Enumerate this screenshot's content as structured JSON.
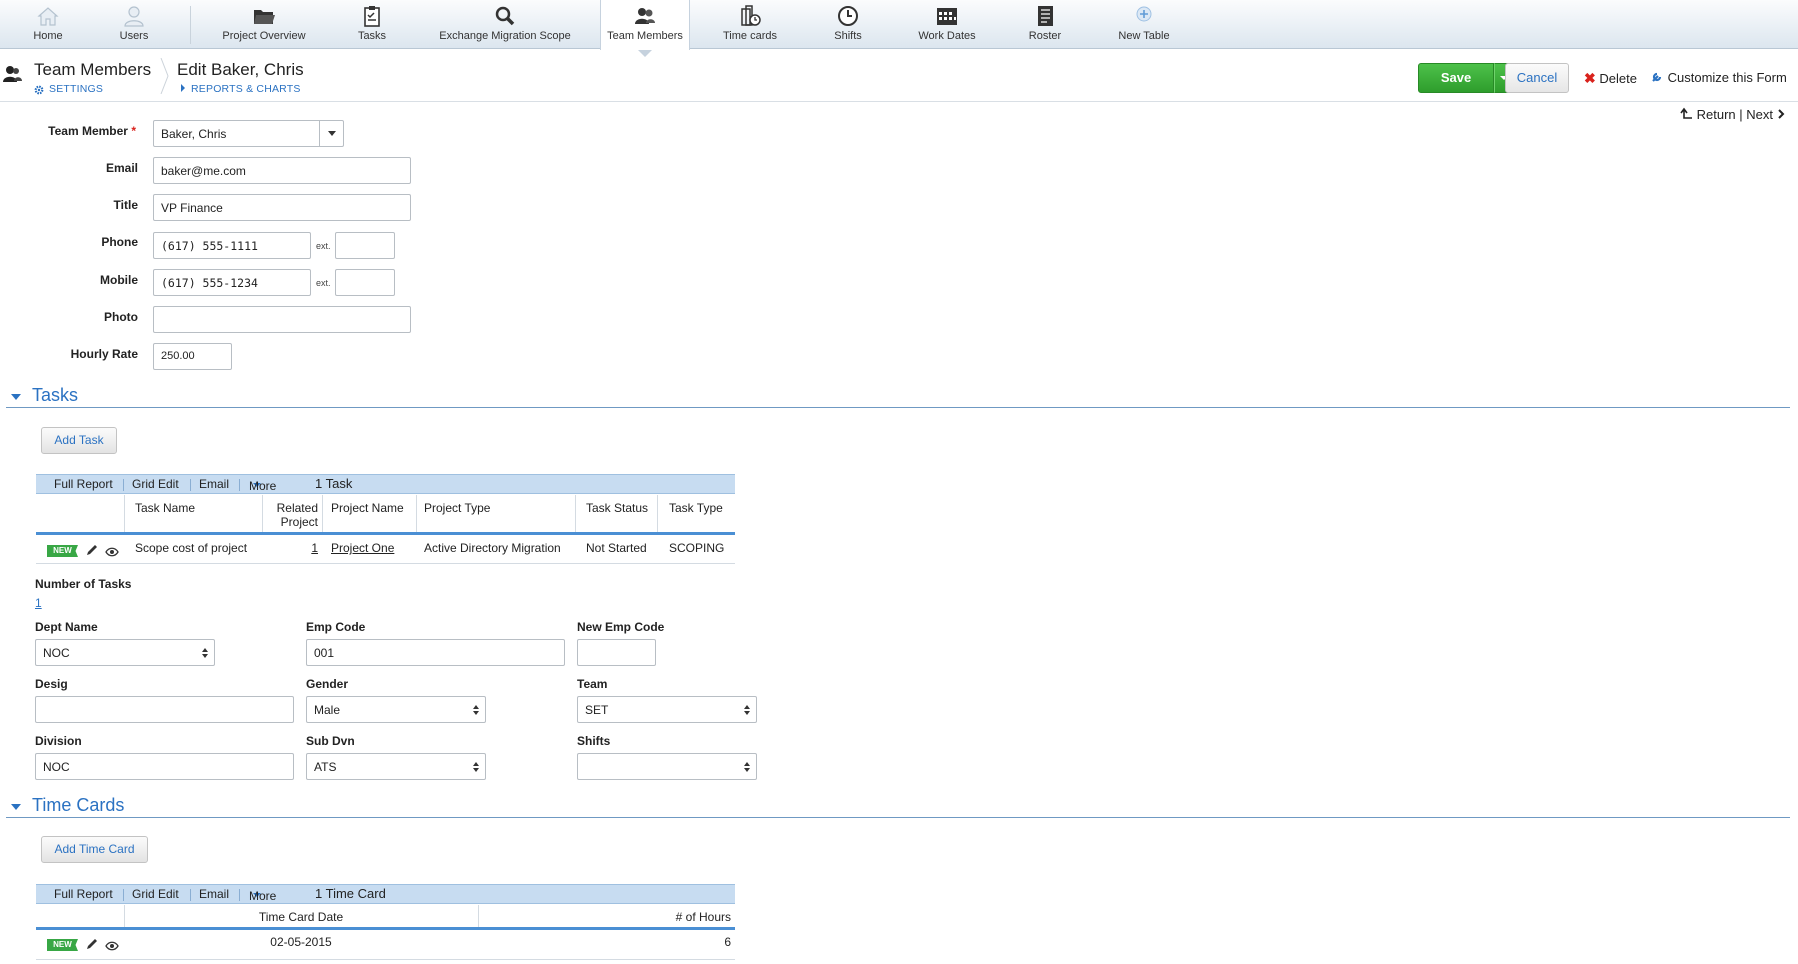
{
  "nav": {
    "items": [
      {
        "label": "Home",
        "icon": "home-icon"
      },
      {
        "label": "Users",
        "icon": "user-icon"
      },
      {
        "label": "Project Overview",
        "icon": "folder-icon"
      },
      {
        "label": "Tasks",
        "icon": "clipboard-icon"
      },
      {
        "label": "Exchange Migration Scope",
        "icon": "magnifier-icon"
      },
      {
        "label": "Team Members",
        "icon": "team-icon"
      },
      {
        "label": "Time cards",
        "icon": "building-clock-icon"
      },
      {
        "label": "Shifts",
        "icon": "clock-icon"
      },
      {
        "label": "Work Dates",
        "icon": "calendar-icon"
      },
      {
        "label": "Roster",
        "icon": "roster-icon"
      },
      {
        "label": "New Table",
        "icon": "add-table-icon"
      }
    ],
    "active": "Team Members"
  },
  "header": {
    "section_title": "Team Members",
    "settings_link": "SETTINGS",
    "record_title": "Edit Baker, Chris",
    "reports_link": "REPORTS & CHARTS",
    "save_label": "Save",
    "cancel_label": "Cancel",
    "delete_label": "Delete",
    "customize_label": "Customize this Form",
    "return_label": "Return",
    "next_label": "Next",
    "nav_sep": "|"
  },
  "form": {
    "team_member": {
      "label": "Team Member",
      "required_mark": "*",
      "value": "Baker, Chris"
    },
    "email": {
      "label": "Email",
      "value": "baker@me.com"
    },
    "title": {
      "label": "Title",
      "value": "VP Finance"
    },
    "phone": {
      "label": "Phone",
      "value": "(617) 555-1111",
      "ext_label": "ext.",
      "ext_value": ""
    },
    "mobile": {
      "label": "Mobile",
      "value": "(617) 555-1234",
      "ext_label": "ext.",
      "ext_value": ""
    },
    "photo": {
      "label": "Photo",
      "value": ""
    },
    "hourly_rate": {
      "label": "Hourly Rate",
      "value": "250.00"
    }
  },
  "tasks": {
    "section_title": "Tasks",
    "add_label": "Add  Task",
    "toolbar": {
      "full_report": "Full Report",
      "grid_edit": "Grid Edit",
      "email": "Email",
      "more": "More",
      "count": "1 Task"
    },
    "columns": {
      "task_name": "Task Name",
      "related_project_1": "Related",
      "related_project_2": "Project",
      "project_name": "Project Name",
      "project_type": "Project Type",
      "task_status": "Task Status",
      "task_type": "Task Type"
    },
    "rows": [
      {
        "badge": "NEW",
        "task_name": "Scope cost of project",
        "related_project": "1",
        "project_name": "Project One",
        "project_type": "Active Directory Migration",
        "task_status": "Not Started",
        "task_type": "SCOPING"
      }
    ],
    "number_label": "Number of Tasks",
    "number_value": "1"
  },
  "extra": {
    "dept_name": {
      "label": "Dept Name",
      "value": "NOC"
    },
    "emp_code": {
      "label": "Emp Code",
      "value": "001"
    },
    "new_emp_code": {
      "label": "New Emp Code",
      "value": ""
    },
    "desig": {
      "label": "Desig",
      "value": ""
    },
    "gender": {
      "label": "Gender",
      "value": "Male"
    },
    "team": {
      "label": "Team",
      "value": "SET"
    },
    "division": {
      "label": "Division",
      "value": "NOC"
    },
    "sub_dvn": {
      "label": "Sub Dvn",
      "value": "ATS"
    },
    "shifts": {
      "label": "Shifts",
      "value": ""
    }
  },
  "time_cards": {
    "section_title": "Time Cards",
    "add_label": "Add  Time Card",
    "toolbar": {
      "full_report": "Full Report",
      "grid_edit": "Grid Edit",
      "email": "Email",
      "more": "More",
      "count": "1 Time Card"
    },
    "columns": {
      "date": "Time Card Date",
      "hours": "# of Hours"
    },
    "rows": [
      {
        "badge": "NEW",
        "date": "02-05-2015",
        "hours": "6"
      }
    ]
  },
  "colors": {
    "accent": "#2b72c2",
    "save": "#3aa83a",
    "grid_header": "#c7dcf1",
    "badge": "#38a745",
    "delete": "#d9221c"
  }
}
